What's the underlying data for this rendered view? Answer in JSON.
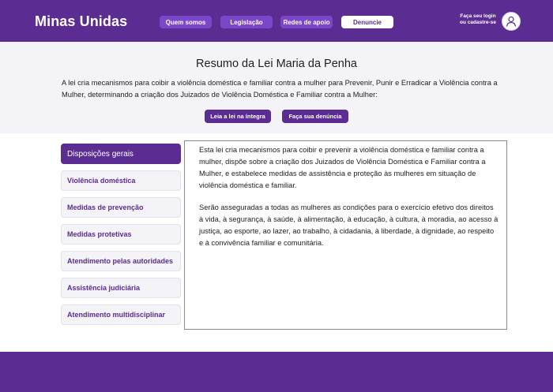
{
  "header": {
    "brand": "Minas Unidas",
    "nav": [
      {
        "label": "Quem somos"
      },
      {
        "label": "Legislação"
      },
      {
        "label": "Redes de apoio"
      },
      {
        "label": "Denuncie"
      }
    ],
    "login_line1": "Faça seu login",
    "login_line2": "ou cadastre-se",
    "avatar_icon": "user-icon"
  },
  "summary": {
    "title": "Resumo da Lei Maria da Penha",
    "text": "A lei cria mecanismos para coibir a violência doméstica e familiar contra a mulher para Prevenir, Punir e Erradicar a Violência contra a Mulher, determinando a criação dos Juizados de Violência Doméstica e Familiar contra a Mulher:",
    "button_read": "Leia a lei na íntegra",
    "button_report": "Faça sua denúncia"
  },
  "sidebar": {
    "items": [
      {
        "label": "Disposições gerais"
      },
      {
        "label": "Violência doméstica"
      },
      {
        "label": "Medidas de prevenção"
      },
      {
        "label": "Medidas protetivas"
      },
      {
        "label": "Atendimento pelas autoridades"
      },
      {
        "label": "Assistência judiciária"
      },
      {
        "label": "Atendimento multidisciplinar"
      }
    ]
  },
  "content": {
    "paragraph1": "Esta lei cria mecanismos para coibir e prevenir a violência doméstica e familiar contra a mulher, dispõe sobre a criação dos Juizados de Violência Doméstica e Familiar contra a Mulher, e estabelece medidas de assistência e proteção às mulheres em situação de violência doméstica e familiar.",
    "paragraph2": "Serão asseguradas a todas as mulheres as condições para o exercício efetivo dos direitos à vida, à segurança, à saúde, à alimentação, à educação, à cultura, à moradia, ao acesso à justiça, ao esporte, ao lazer, ao trabalho, à cidadania, à liberdade, à dignidade, ao respeito e à convivência familiar e comunitária."
  },
  "colors": {
    "primary": "#5b2c91",
    "nav_button": "#7b46c7",
    "band_background": "#f4f3f7"
  }
}
